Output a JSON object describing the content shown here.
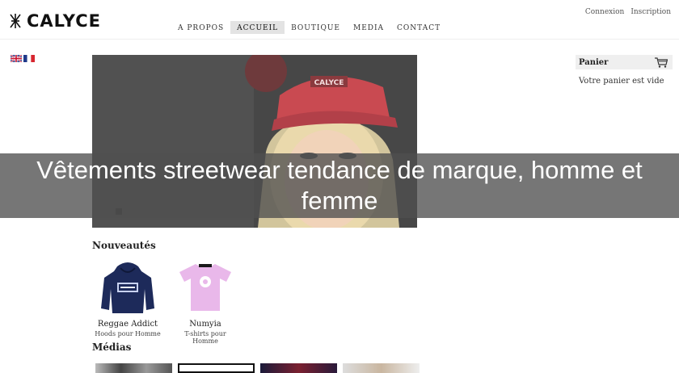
{
  "header": {
    "brand": "CALYCE",
    "nav": [
      {
        "label": "A PROPOS",
        "active": false
      },
      {
        "label": "ACCUEIL",
        "active": true
      },
      {
        "label": "BOUTIQUE",
        "active": false
      },
      {
        "label": "MEDIA",
        "active": false
      },
      {
        "label": "CONTACT",
        "active": false
      }
    ],
    "account": {
      "login": "Connexion",
      "register": "Inscription"
    }
  },
  "languages": [
    "en",
    "fr"
  ],
  "hero": {
    "slides": 3,
    "active_slide": 1
  },
  "cart": {
    "title": "Panier",
    "empty_text": "Votre panier est vide"
  },
  "overlay": {
    "title": "Vêtements streetwear tendance de marque, homme et femme"
  },
  "new_products": {
    "title": "Nouveautés",
    "items": [
      {
        "name": "Reggae Addict",
        "category": "Hoods pour Homme",
        "color": "#1d2a5a"
      },
      {
        "name": "Numyia",
        "category": "T-shirts pour Homme",
        "color": "#e9b8ea"
      }
    ]
  },
  "medias": {
    "title": "Médias"
  }
}
